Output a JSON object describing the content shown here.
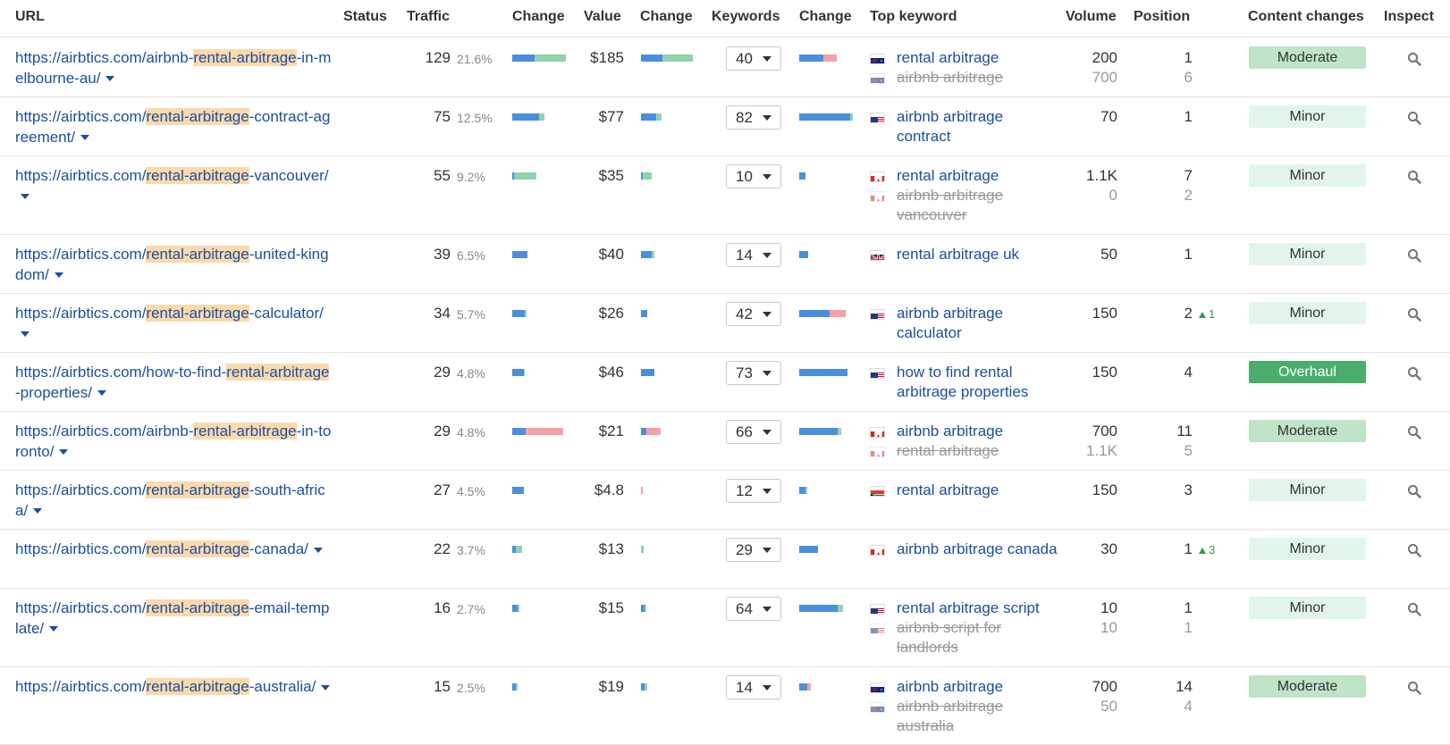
{
  "table": {
    "headers": {
      "url": "URL",
      "status": "Status",
      "traffic": "Traffic",
      "traffic_change": "Change",
      "value": "Value",
      "value_change": "Change",
      "keywords": "Keywords",
      "keywords_change": "Change",
      "top_keyword": "Top keyword",
      "volume": "Volume",
      "position": "Position",
      "content_changes": "Content changes",
      "inspect": "Inspect"
    },
    "colors": {
      "bar_blue": "#4a8fde",
      "bar_green": "#8fd3ad",
      "bar_red": "#f5a0a4",
      "bar_blue2": "#3f7fd0"
    },
    "rows": [
      {
        "url_parts": [
          [
            "https://airbtics.com/airbnb-",
            false
          ],
          [
            "rental-arbitrage",
            true
          ],
          [
            "-in-melbourne-au/",
            false
          ]
        ],
        "traffic": "129",
        "share": "21.6%",
        "traffic_bar": [
          {
            "c": "b",
            "v": 0.42
          },
          {
            "c": "g",
            "v": 0.58
          }
        ],
        "value": "$185",
        "value_bar": [
          {
            "c": "b",
            "v": 0.42
          },
          {
            "c": "g",
            "v": 0.58
          }
        ],
        "keywords": "40",
        "keywords_bar": [
          {
            "c": "b",
            "v": 0.45
          },
          {
            "c": "r",
            "v": 0.25
          }
        ],
        "keywords_list": [
          {
            "flag": "au",
            "text": "rental arbitrage",
            "strike": false
          },
          {
            "flag": "au",
            "text": "airbnb arbitrage",
            "strike": true
          }
        ],
        "volume": [
          "200",
          "700"
        ],
        "position": [
          "1",
          "6"
        ],
        "position_delta": "",
        "content": "Moderate",
        "content_level": "moderate"
      },
      {
        "url_parts": [
          [
            "https://airbtics.com/",
            false
          ],
          [
            "rental-arbitrage",
            true
          ],
          [
            "-contract-agreement/",
            false
          ]
        ],
        "traffic": "75",
        "share": "12.5%",
        "traffic_bar": [
          {
            "c": "b",
            "v": 0.5
          },
          {
            "c": "g",
            "v": 0.1
          }
        ],
        "value": "$77",
        "value_bar": [
          {
            "c": "b",
            "v": 0.3
          },
          {
            "c": "g",
            "v": 0.1
          }
        ],
        "keywords": "82",
        "keywords_bar": [
          {
            "c": "b",
            "v": 0.95
          },
          {
            "c": "g",
            "v": 0.05
          }
        ],
        "keywords_list": [
          {
            "flag": "us",
            "text": "airbnb arbitrage contract",
            "strike": false
          }
        ],
        "volume": [
          "70"
        ],
        "position": [
          "1"
        ],
        "position_delta": "",
        "content": "Minor",
        "content_level": "minor"
      },
      {
        "url_parts": [
          [
            "https://airbtics.com/",
            false
          ],
          [
            "rental-arbitrage",
            true
          ],
          [
            "-vancouver/",
            false
          ]
        ],
        "traffic": "55",
        "share": "9.2%",
        "traffic_bar": [
          {
            "c": "b",
            "v": 0.03
          },
          {
            "c": "g",
            "v": 0.42
          }
        ],
        "value": "$35",
        "value_bar": [
          {
            "c": "b",
            "v": 0.03
          },
          {
            "c": "g",
            "v": 0.17
          }
        ],
        "keywords": "10",
        "keywords_bar": [
          {
            "c": "b",
            "v": 0.12
          }
        ],
        "keywords_list": [
          {
            "flag": "ca",
            "text": "rental arbitrage",
            "strike": false
          },
          {
            "flag": "ca",
            "text": "airbnb arbitrage vancouver",
            "strike": true
          }
        ],
        "volume": [
          "1.1K",
          "0"
        ],
        "position": [
          "7",
          "2"
        ],
        "position_delta": "",
        "content": "Minor",
        "content_level": "minor"
      },
      {
        "url_parts": [
          [
            "https://airbtics.com/",
            false
          ],
          [
            "rental-arbitrage",
            true
          ],
          [
            "-united-kingdom/",
            false
          ]
        ],
        "traffic": "39",
        "share": "6.5%",
        "traffic_bar": [
          {
            "c": "b",
            "v": 0.28
          }
        ],
        "value": "$40",
        "value_bar": [
          {
            "c": "b",
            "v": 0.2
          },
          {
            "c": "g",
            "v": 0.05
          }
        ],
        "keywords": "14",
        "keywords_bar": [
          {
            "c": "b",
            "v": 0.17
          }
        ],
        "keywords_list": [
          {
            "flag": "uk",
            "text": "rental arbitrage uk",
            "strike": false
          }
        ],
        "volume": [
          "50"
        ],
        "position": [
          "1"
        ],
        "position_delta": "",
        "content": "Minor",
        "content_level": "minor"
      },
      {
        "url_parts": [
          [
            "https://airbtics.com/",
            false
          ],
          [
            "rental-arbitrage",
            true
          ],
          [
            "-calculator/",
            false
          ]
        ],
        "traffic": "34",
        "share": "5.7%",
        "traffic_bar": [
          {
            "c": "b",
            "v": 0.24
          },
          {
            "c": "g",
            "v": 0.03
          }
        ],
        "value": "$26",
        "value_bar": [
          {
            "c": "b",
            "v": 0.12
          }
        ],
        "keywords": "42",
        "keywords_bar": [
          {
            "c": "b",
            "v": 0.57
          },
          {
            "c": "r",
            "v": 0.3
          }
        ],
        "keywords_list": [
          {
            "flag": "us",
            "text": "airbnb arbitrage calculator",
            "strike": false
          }
        ],
        "volume": [
          "150"
        ],
        "position": [
          "2"
        ],
        "position_delta": "1",
        "content": "Minor",
        "content_level": "minor"
      },
      {
        "url_parts": [
          [
            "https://airbtics.com/how-to-find-",
            false
          ],
          [
            "rental-arbitrage",
            true
          ],
          [
            "-properties/",
            false
          ]
        ],
        "traffic": "29",
        "share": "4.8%",
        "traffic_bar": [
          {
            "c": "b",
            "v": 0.22
          },
          {
            "c": "g",
            "v": 0.02
          }
        ],
        "value": "$46",
        "value_bar": [
          {
            "c": "b",
            "v": 0.25
          }
        ],
        "keywords": "73",
        "keywords_bar": [
          {
            "c": "b",
            "v": 0.9
          }
        ],
        "keywords_list": [
          {
            "flag": "us",
            "text": "how to find rental arbitrage properties",
            "strike": false
          }
        ],
        "volume": [
          "150"
        ],
        "position": [
          "4"
        ],
        "position_delta": "",
        "content": "Overhaul",
        "content_level": "overhaul"
      },
      {
        "url_parts": [
          [
            "https://airbtics.com/airbnb-",
            false
          ],
          [
            "rental-arbitrage",
            true
          ],
          [
            "-in-toronto/",
            false
          ]
        ],
        "traffic": "29",
        "share": "4.8%",
        "traffic_bar": [
          {
            "c": "b",
            "v": 0.25
          },
          {
            "c": "r",
            "v": 0.7
          }
        ],
        "value": "$21",
        "value_bar": [
          {
            "c": "b",
            "v": 0.1
          },
          {
            "c": "r",
            "v": 0.27
          }
        ],
        "keywords": "66",
        "keywords_bar": [
          {
            "c": "b",
            "v": 0.72
          },
          {
            "c": "g",
            "v": 0.06
          }
        ],
        "keywords_list": [
          {
            "flag": "ca",
            "text": "airbnb arbitrage",
            "strike": false
          },
          {
            "flag": "ca",
            "text": "rental arbitrage",
            "strike": true
          }
        ],
        "volume": [
          "700",
          "1.1K"
        ],
        "position": [
          "11",
          "5"
        ],
        "position_delta": "",
        "content": "Moderate",
        "content_level": "moderate"
      },
      {
        "url_parts": [
          [
            "https://airbtics.com/",
            false
          ],
          [
            "rental-arbitrage",
            true
          ],
          [
            "-south-africa/",
            false
          ]
        ],
        "traffic": "27",
        "share": "4.5%",
        "traffic_bar": [
          {
            "c": "b",
            "v": 0.22
          }
        ],
        "value": "$4.8",
        "value_bar": [
          {
            "c": "r",
            "v": 0.04
          }
        ],
        "keywords": "12",
        "keywords_bar": [
          {
            "c": "b",
            "v": 0.12
          },
          {
            "c": "g",
            "v": 0.03
          }
        ],
        "keywords_list": [
          {
            "flag": "za",
            "text": "rental arbitrage",
            "strike": false
          }
        ],
        "volume": [
          "150"
        ],
        "position": [
          "3"
        ],
        "position_delta": "",
        "content": "Minor",
        "content_level": "minor"
      },
      {
        "url_parts": [
          [
            "https://airbtics.com/",
            false
          ],
          [
            "rental-arbitrage",
            true
          ],
          [
            "-canada/",
            false
          ]
        ],
        "traffic": "22",
        "share": "3.7%",
        "traffic_bar": [
          {
            "c": "b",
            "v": 0.07
          },
          {
            "c": "g",
            "v": 0.12
          }
        ],
        "value": "$13",
        "value_bar": [
          {
            "c": "g",
            "v": 0.06
          }
        ],
        "keywords": "29",
        "keywords_bar": [
          {
            "c": "b",
            "v": 0.35
          }
        ],
        "keywords_list": [
          {
            "flag": "ca",
            "text": "airbnb arbitrage canada",
            "strike": false
          }
        ],
        "volume": [
          "30"
        ],
        "position": [
          "1"
        ],
        "position_delta": "3",
        "content": "Minor",
        "content_level": "minor"
      },
      {
        "url_parts": [
          [
            "https://airbtics.com/",
            false
          ],
          [
            "rental-arbitrage",
            true
          ],
          [
            "-email-template/",
            false
          ]
        ],
        "traffic": "16",
        "share": "2.7%",
        "traffic_bar": [
          {
            "c": "b",
            "v": 0.1
          },
          {
            "c": "g",
            "v": 0.03
          }
        ],
        "value": "$15",
        "value_bar": [
          {
            "c": "b",
            "v": 0.07
          },
          {
            "c": "g",
            "v": 0.04
          }
        ],
        "keywords": "64",
        "keywords_bar": [
          {
            "c": "b",
            "v": 0.72
          },
          {
            "c": "g",
            "v": 0.1
          }
        ],
        "keywords_list": [
          {
            "flag": "us",
            "text": "rental arbitrage script",
            "strike": false
          },
          {
            "flag": "us",
            "text": "airbnb script for landlords",
            "strike": true
          }
        ],
        "volume": [
          "10",
          "10"
        ],
        "position": [
          "1",
          "1"
        ],
        "position_delta": "",
        "content": "Minor",
        "content_level": "minor"
      },
      {
        "url_parts": [
          [
            "https://airbtics.com/",
            false
          ],
          [
            "rental-arbitrage",
            true
          ],
          [
            "-australia/",
            false
          ]
        ],
        "traffic": "15",
        "share": "2.5%",
        "traffic_bar": [
          {
            "c": "b",
            "v": 0.07
          },
          {
            "c": "g",
            "v": 0.03
          }
        ],
        "value": "$19",
        "value_bar": [
          {
            "c": "b",
            "v": 0.07
          },
          {
            "c": "g",
            "v": 0.05
          }
        ],
        "keywords": "14",
        "keywords_bar": [
          {
            "c": "b",
            "v": 0.15
          },
          {
            "c": "r",
            "v": 0.06
          }
        ],
        "keywords_list": [
          {
            "flag": "au",
            "text": "airbnb arbitrage",
            "strike": false
          },
          {
            "flag": "au",
            "text": "airbnb arbitrage australia",
            "strike": true
          }
        ],
        "volume": [
          "700",
          "50"
        ],
        "position": [
          "14",
          "4"
        ],
        "position_delta": "",
        "content": "Moderate",
        "content_level": "moderate"
      }
    ]
  }
}
